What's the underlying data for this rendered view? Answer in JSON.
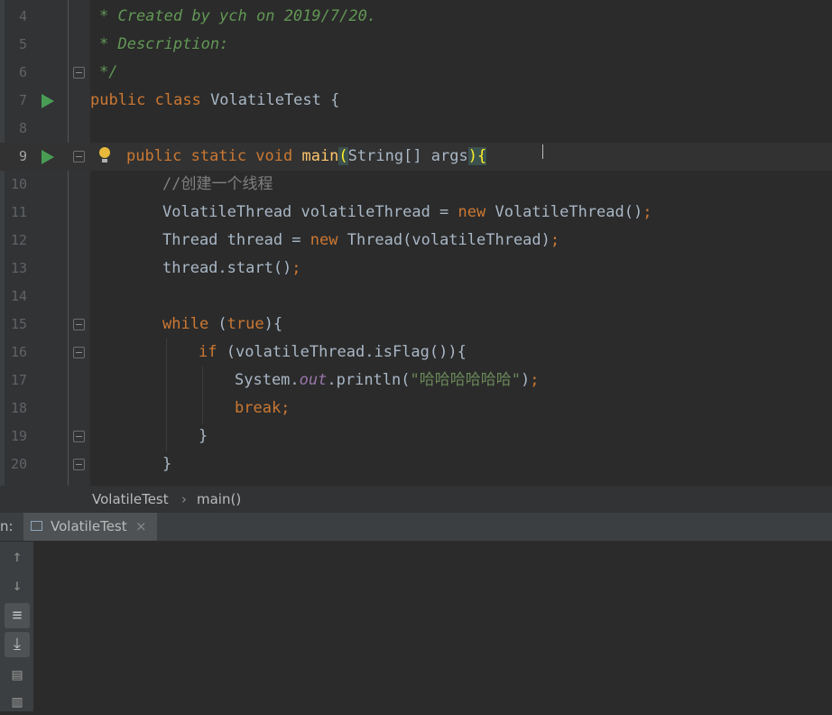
{
  "editor": {
    "lines": [
      {
        "n": "4",
        "text": "* Created by ych on 2019/7/20."
      },
      {
        "n": "5",
        "text": "* Description:"
      },
      {
        "n": "6",
        "text": "*/"
      },
      {
        "n": "7",
        "text": "public class VolatileTest {"
      },
      {
        "n": "8",
        "text": ""
      },
      {
        "n": "9",
        "text": "public static void main(String[] args){"
      },
      {
        "n": "10",
        "text": "//创建一个线程"
      },
      {
        "n": "11",
        "text": "VolatileThread volatileThread = new VolatileThread();"
      },
      {
        "n": "12",
        "text": "Thread thread = new Thread(volatileThread);"
      },
      {
        "n": "13",
        "text": "thread.start();"
      },
      {
        "n": "14",
        "text": ""
      },
      {
        "n": "15",
        "text": "while (true){"
      },
      {
        "n": "16",
        "text": "if (volatileThread.isFlag()){"
      },
      {
        "n": "17",
        "text": "System.out.println(\"哈哈哈哈哈哈\");"
      },
      {
        "n": "18",
        "text": "break;"
      },
      {
        "n": "19",
        "text": "}"
      },
      {
        "n": "20",
        "text": "}"
      }
    ],
    "current_line": "9"
  },
  "breadcrumb": {
    "class_name": "VolatileTest",
    "separator": "›",
    "method": "main()"
  },
  "run_panel": {
    "prefix": "n:",
    "tab_label": "VolatileTest",
    "tab_close": "×",
    "side_icons": [
      "arrow-up-icon",
      "arrow-down-icon",
      "soft-wrap-icon",
      "scroll-to-end-icon",
      "print-icon",
      "trash-icon"
    ]
  },
  "colors": {
    "keyword": "#cc7832",
    "comment": "#629755",
    "string": "#6a8759",
    "method": "#ffc66d",
    "static_field": "#9876aa",
    "run": "#499c54"
  }
}
